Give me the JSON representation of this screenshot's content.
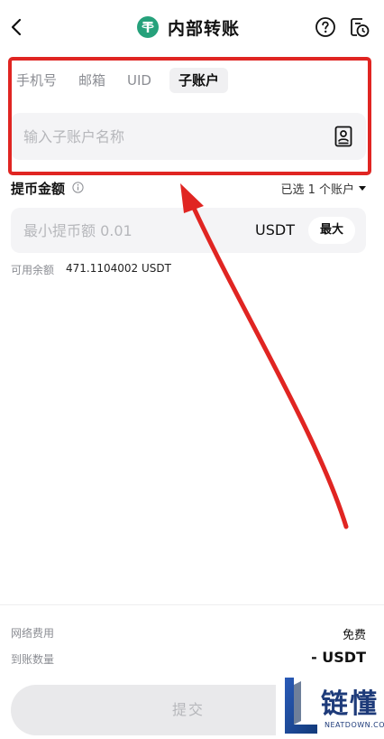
{
  "header": {
    "title": "内部转账"
  },
  "tabs": [
    {
      "label": "手机号",
      "active": false
    },
    {
      "label": "邮箱",
      "active": false
    },
    {
      "label": "UID",
      "active": false
    },
    {
      "label": "子账户",
      "active": true
    }
  ],
  "sub_account": {
    "placeholder": "输入子账户名称",
    "value": ""
  },
  "amount": {
    "label": "提币金额",
    "selected_accounts": "已选 1 个账户",
    "placeholder": "最小提币额 0.01",
    "unit": "USDT",
    "max_label": "最大",
    "available_label": "可用余额",
    "available_value": "471.1104002 USDT"
  },
  "footer": {
    "fee_label": "网络费用",
    "fee_value": "免费",
    "receive_label": "到账数量",
    "receive_value": "- USDT",
    "submit_label": "提交"
  },
  "watermark": {
    "text": "链懂",
    "sub": "NEATDOWN.COM"
  },
  "colors": {
    "accent_green": "#26a17b",
    "highlight_red": "#e02522",
    "input_bg": "#f4f4f6"
  }
}
